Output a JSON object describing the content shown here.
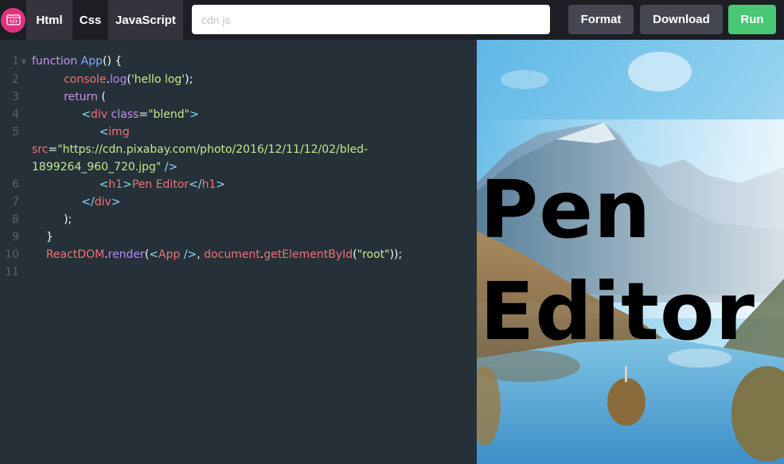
{
  "topbar": {
    "logo_icon": "code-window-icon",
    "tabs": [
      {
        "label": "Html",
        "active": false
      },
      {
        "label": "Css",
        "active": true
      },
      {
        "label": "JavaScript",
        "active": false
      }
    ],
    "cdn_input": {
      "value": "",
      "placeholder": "cdn js"
    },
    "buttons": {
      "format": "Format",
      "download": "Download",
      "run": "Run"
    },
    "colors": {
      "logo": "#e0317f",
      "run": "#48c774",
      "button": "#444651"
    }
  },
  "editor": {
    "lines": [
      {
        "number": "1",
        "foldable": true
      },
      {
        "number": "2"
      },
      {
        "number": "3"
      },
      {
        "number": "4"
      },
      {
        "number": "5"
      },
      {
        "number": "6"
      },
      {
        "number": "7"
      },
      {
        "number": "8"
      },
      {
        "number": "9"
      },
      {
        "number": "10"
      },
      {
        "number": "11"
      }
    ],
    "tokens": {
      "l1": [
        "function",
        "App",
        "() {"
      ],
      "l2": [
        "console",
        ".",
        "log",
        "(",
        "'hello log'",
        ");"
      ],
      "l3": [
        "return",
        " ("
      ],
      "l4": [
        "<",
        "div",
        " class",
        "=",
        "\"blend\"",
        ">"
      ],
      "l5": [
        "<",
        "img"
      ],
      "l5b": [
        "src",
        "=",
        "\"https://cdn.pixabay.com/photo/2016/12/11/12/02/bled-"
      ],
      "l5c": [
        "1899264_960_720.jpg\"",
        " />"
      ],
      "l6": [
        "<",
        "h1",
        ">",
        "Pen Editor",
        "</",
        "h1",
        ">"
      ],
      "l7": [
        "</",
        "div",
        ">"
      ],
      "l8": [
        ");"
      ],
      "l9": [
        "}"
      ],
      "l10": [
        "ReactDOM",
        ".",
        "render",
        "(",
        "<",
        "App",
        " />",
        ", ",
        "document",
        ".",
        "getElementById",
        "(",
        "\"root\"",
        "));"
      ]
    }
  },
  "preview": {
    "heading": "Pen Editor",
    "image_description": "mountain-lake-landscape-image"
  }
}
